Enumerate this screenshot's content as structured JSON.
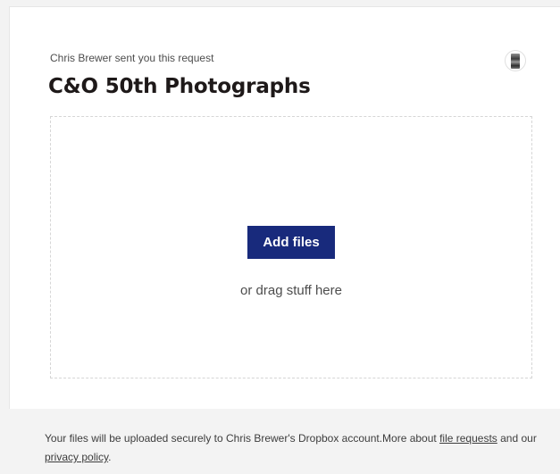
{
  "request": {
    "sender_line": "Chris Brewer sent you this request",
    "title": "C&O 50th Photographs"
  },
  "upload": {
    "button_label": "Add files",
    "drag_hint": "or drag stuff here"
  },
  "footer": {
    "text_before": "Your files will be uploaded securely to Chris Brewer's Dropbox account.More about ",
    "link_file_requests": "file requests",
    "text_middle": " and our ",
    "link_privacy": "privacy policy",
    "text_end": "."
  },
  "colors": {
    "button": "#182a7c",
    "background": "#f3f3f3",
    "card": "#ffffff"
  }
}
